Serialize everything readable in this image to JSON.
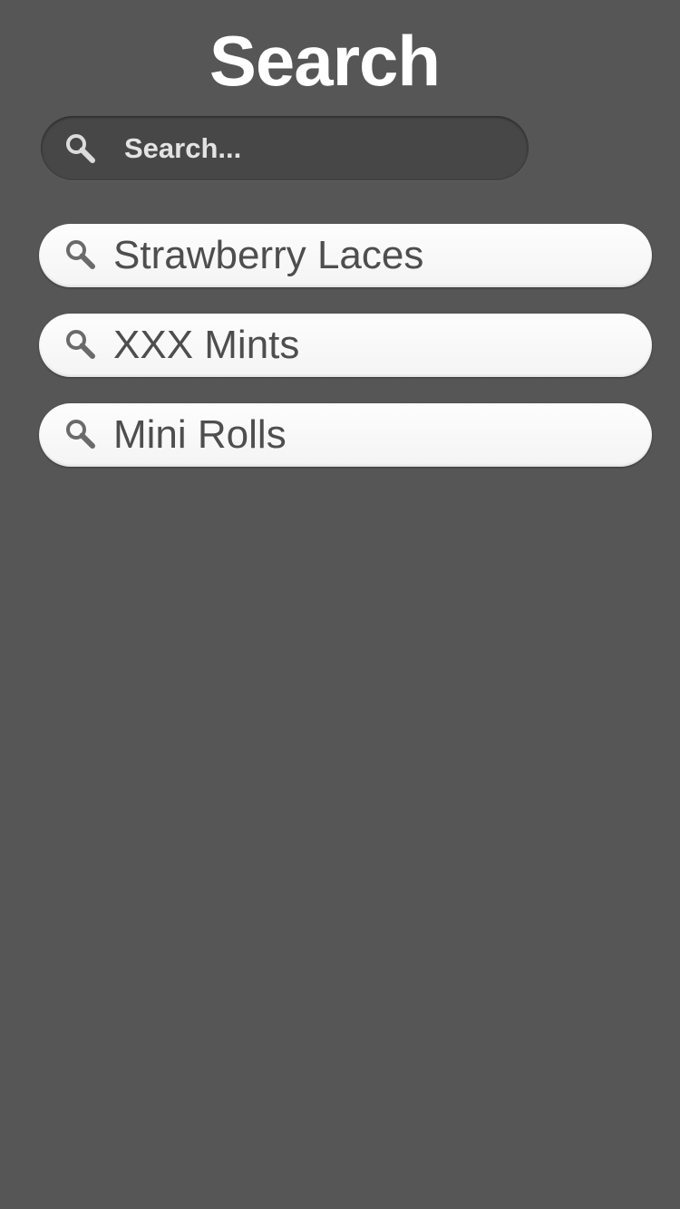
{
  "header": {
    "title": "Search"
  },
  "search": {
    "placeholder": "Search...",
    "value": "",
    "icon": "search-icon"
  },
  "results": [
    {
      "label": "Strawberry Laces",
      "icon": "search-icon"
    },
    {
      "label": "XXX Mints",
      "icon": "search-icon"
    },
    {
      "label": "Mini Rolls",
      "icon": "search-icon"
    }
  ],
  "colors": {
    "background": "#565656",
    "search_bar": "#474747",
    "result_pill": "#fafafa",
    "result_text": "#4e4e4e",
    "title_text": "#ffffff"
  }
}
